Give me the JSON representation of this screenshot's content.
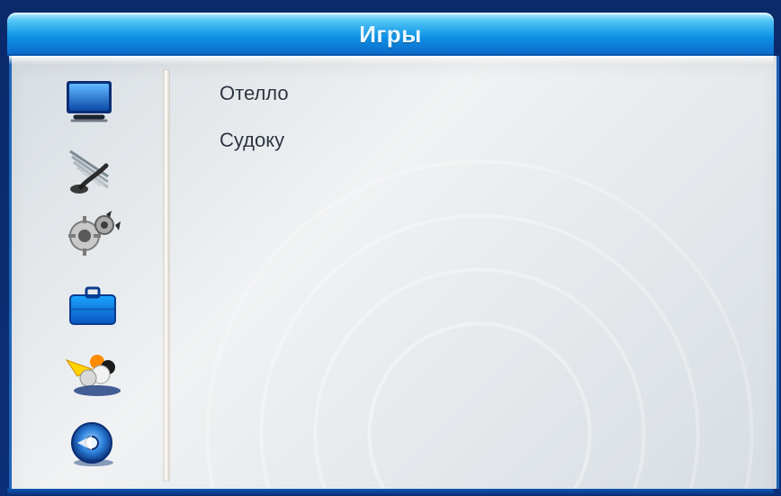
{
  "window": {
    "title": "Игры"
  },
  "menu": {
    "items": [
      {
        "label": "Отелло"
      },
      {
        "label": "Судоку"
      }
    ]
  },
  "sidebar": {
    "icons": [
      {
        "icon": "tv-icon"
      },
      {
        "icon": "satellite-dish-icon"
      },
      {
        "icon": "gears-icon"
      },
      {
        "icon": "briefcase-icon"
      },
      {
        "icon": "games-icon"
      },
      {
        "icon": "media-disc-icon"
      }
    ]
  },
  "colors": {
    "header_blue": "#0f93e6",
    "panel_light": "#e9eef1",
    "menu_text": "#2d3440"
  }
}
